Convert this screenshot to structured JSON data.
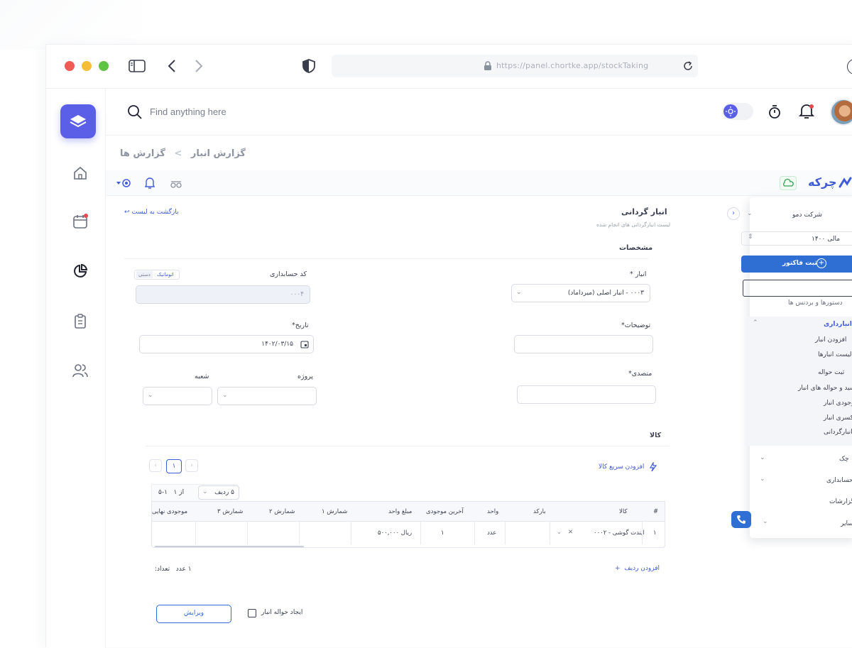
{
  "browser": {
    "url": "https://panel.chortke.app/stockTaking"
  },
  "header": {
    "search_placeholder": "Find anything here"
  },
  "breadcrumb": {
    "parent": "گزارش ها",
    "separator": ">",
    "current": "گزارش انبار"
  },
  "brand": {
    "name": "چرکه"
  },
  "page": {
    "title": "انبار گردانی",
    "subtitle": "لیست انبارگردانی های انجام شده",
    "back_link": "بازگشت به لیست",
    "section_specs": "مشخصات",
    "section_items": "کالا"
  },
  "form": {
    "warehouse_label": "انبار *",
    "warehouse_value": "۰۰۰۳ - انبار اصلی (میرداماد)",
    "accounting_code_label": "کد حسابداری",
    "accounting_code_value": "۰۰۰۴",
    "mode_auto": "اتوماتیک",
    "mode_manual": "دستی",
    "description_label": "توضیحات*",
    "date_label": "تاریخ*",
    "date_value": "۱۴۰۲/۰۳/۱۵",
    "responsible_label": "متصدی*",
    "project_label": "پروژه",
    "branch_label": "شعبه"
  },
  "items": {
    "quick_add": "افزودن سریع کالا",
    "page_number": "۱",
    "rows_per_page": "۵ ردیف",
    "range_text": "۱-۵",
    "of_text": "از ۱",
    "columns": [
      "#",
      "کالا",
      "بارکد",
      "واحد",
      "آخرین موجودی",
      "مبلغ واحد",
      "شمارش ۱",
      "شمارش ۲",
      "شمارش ۳",
      "موجودی نهایی"
    ],
    "rows": [
      {
        "index": "۱",
        "product": "۰۰۰۲ - ایندت گوشی",
        "barcode": "",
        "unit": "عدد",
        "last_stock": "۱",
        "unit_price": "ریال ۵۰۰,۰۰۰",
        "count1": "",
        "count2": "",
        "count3": "",
        "final_stock": ""
      }
    ],
    "add_row": "افزودن ردیف",
    "count_label": "تعداد:",
    "count_value": "۱ عدد"
  },
  "footer": {
    "edit_button": "ویرایش",
    "create_transfer_label": "ایجاد حواله انبار"
  },
  "right_menu": {
    "company": "شرکت دمو",
    "fiscal_year": "مالی ۱۴۰۰",
    "new_invoice": "ثبت فاکتور",
    "partial_item": "دستورها و بردنس ها",
    "warehouse_section": "انبارداری",
    "warehouse_items": [
      "افزودن انبار",
      "لیست انبارها",
      "ثبت حواله",
      "رسید و حواله های انبار",
      "موجودی انبار",
      "کسری انبار",
      "انبارگردانی"
    ],
    "other_sections": [
      "چک",
      "حسابداری",
      "گزارشات",
      "سایر"
    ]
  },
  "colors": {
    "accent": "#5b5fe8",
    "link": "#3f5bd6",
    "primary_button": "#2f6fd4",
    "notification_dot": "#e5484d"
  }
}
